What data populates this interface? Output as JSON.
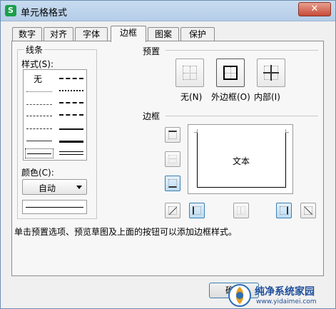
{
  "window": {
    "title": "单元格格式",
    "app_icon_letter": "S",
    "close_glyph": "✕"
  },
  "tabs": [
    {
      "label": "数字"
    },
    {
      "label": "对齐"
    },
    {
      "label": "字体"
    },
    {
      "label": "边框",
      "active": true
    },
    {
      "label": "图案"
    },
    {
      "label": "保护"
    }
  ],
  "line": {
    "group_label": "线条",
    "style_label": "样式(S):",
    "none_label": "无",
    "color_label": "颜色(C):",
    "color_value": "自动"
  },
  "preset": {
    "group_label": "预置",
    "buttons": [
      {
        "label": "无(N)",
        "icon": "border-none-icon"
      },
      {
        "label": "外边框(O)",
        "icon": "border-outline-icon"
      },
      {
        "label": "内部(I)",
        "icon": "border-inside-icon"
      }
    ]
  },
  "border": {
    "group_label": "边框",
    "preview_text": "文本"
  },
  "hint": "单击预置选项、预览草图及上面的按钮可以添加边框样式。",
  "footer": {
    "ok_label": "确定"
  },
  "watermark": {
    "text": "纯净系统家园",
    "url": "www.yidaimei.com"
  },
  "colors": {
    "accent": "#3c7fb1",
    "close": "#c74a38",
    "title_bar": "#c8dcf0"
  }
}
